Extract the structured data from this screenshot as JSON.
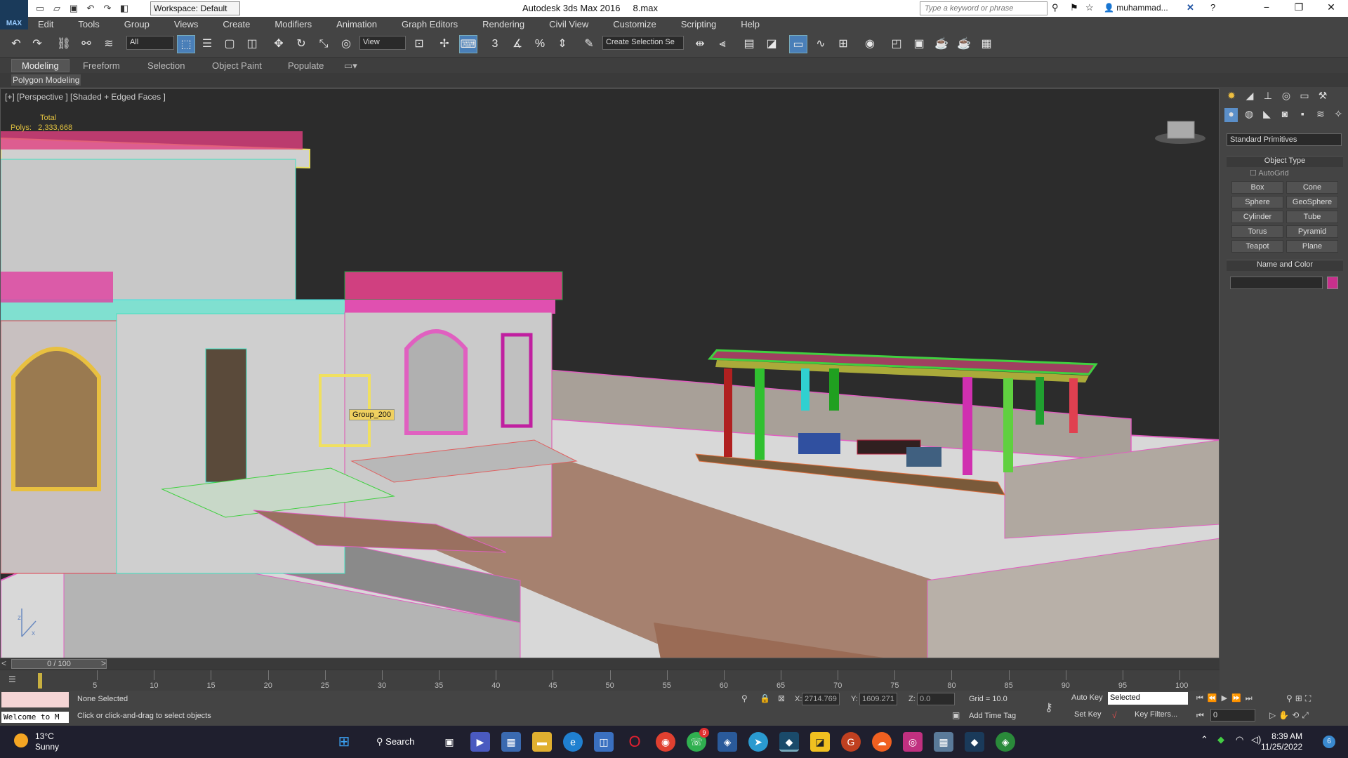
{
  "titlebar": {
    "logo": "MAX",
    "workspace": "Workspace: Default",
    "app_title": "Autodesk 3ds Max 2016",
    "file_name": "8.max",
    "search_placeholder": "Type a keyword or phrase",
    "user": "muhammad..."
  },
  "menu": [
    "Edit",
    "Tools",
    "Group",
    "Views",
    "Create",
    "Modifiers",
    "Animation",
    "Graph Editors",
    "Rendering",
    "Civil View",
    "Customize",
    "Scripting",
    "Help"
  ],
  "toolbar": {
    "selection_filter": "All",
    "ref_coord": "View",
    "named_selection": "Create Selection Se"
  },
  "ribbon": {
    "tabs": [
      "Modeling",
      "Freeform",
      "Selection",
      "Object Paint",
      "Populate"
    ],
    "panel": "Polygon Modeling"
  },
  "viewport": {
    "label": "[+] [Perspective ] [Shaded + Edged Faces ]",
    "stats_total": "Total",
    "stats_polys": "Polys:",
    "stats_polys_value": "2,333,668",
    "tooltip": "Group_200",
    "axis_x": "x",
    "axis_z": "z"
  },
  "command_panel": {
    "primitive_type": "Standard Primitives",
    "object_type_header": "Object Type",
    "autogrid": "AutoGrid",
    "buttons": [
      "Box",
      "Cone",
      "Sphere",
      "GeoSphere",
      "Cylinder",
      "Tube",
      "Torus",
      "Pyramid",
      "Teapot",
      "Plane"
    ],
    "name_color_header": "Name and Color",
    "object_color": "#c8308c"
  },
  "timeline": {
    "slider": "0 / 100",
    "ticks": [
      "5",
      "10",
      "15",
      "20",
      "25",
      "30",
      "35",
      "40",
      "45",
      "50",
      "55",
      "60",
      "65",
      "70",
      "75",
      "80",
      "85",
      "90",
      "95",
      "100"
    ]
  },
  "status": {
    "maxscript": "Welcome to M",
    "selection_info": "None Selected",
    "prompt": "Click or click-and-drag to select objects",
    "x_label": "X:",
    "x_value": "2714.769",
    "y_label": "Y:",
    "y_value": "1609.271",
    "z_label": "Z:",
    "z_value": "0.0",
    "grid": "Grid = 10.0",
    "add_time_tag": "Add Time Tag",
    "auto_key": "Auto Key",
    "set_key": "Set Key",
    "key_mode": "Selected",
    "key_filters": "Key Filters...",
    "frame": "0"
  },
  "taskbar": {
    "temperature": "13°C",
    "condition": "Sunny",
    "search": "Search",
    "time": "8:39 AM",
    "date": "11/25/2022",
    "notification_count": "6",
    "whatsapp_badge": "9"
  }
}
